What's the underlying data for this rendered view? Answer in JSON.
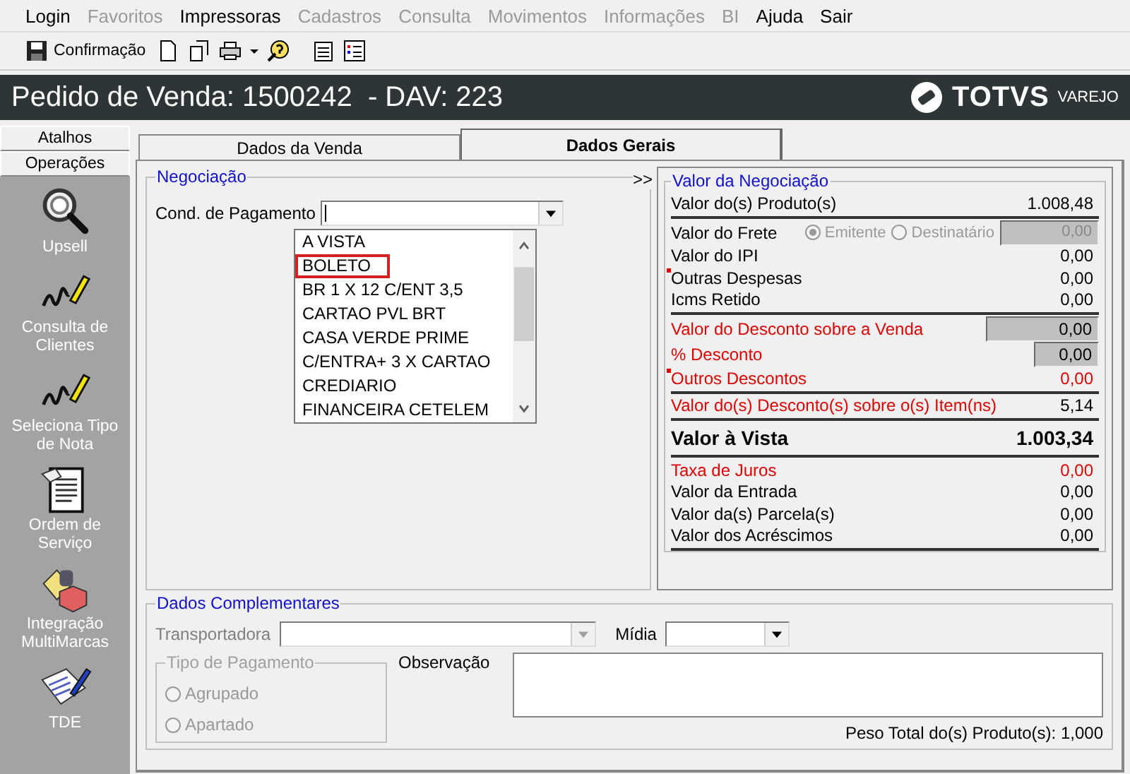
{
  "menu": [
    {
      "label": "Login",
      "disabled": false
    },
    {
      "label": "Favoritos",
      "disabled": true
    },
    {
      "label": "Impressoras",
      "disabled": false
    },
    {
      "label": "Cadastros",
      "disabled": true
    },
    {
      "label": "Consulta",
      "disabled": true
    },
    {
      "label": "Movimentos",
      "disabled": true
    },
    {
      "label": "Informações",
      "disabled": true
    },
    {
      "label": "BI",
      "disabled": true
    },
    {
      "label": "Ajuda",
      "disabled": false
    },
    {
      "label": "Sair",
      "disabled": false
    }
  ],
  "toolbar": {
    "confirm_label": "Confirmação"
  },
  "header": {
    "title": "Pedido de Venda: 1500242  - DAV: 223",
    "logo": "TOTVS",
    "logo_sub": "VAREJO"
  },
  "sidebar": {
    "tabs": [
      {
        "label": "Atalhos"
      },
      {
        "label": "Operações"
      }
    ],
    "items": [
      {
        "label": "Upsell",
        "kind": "magnifier"
      },
      {
        "label": "Consulta de Clientes",
        "kind": "pen"
      },
      {
        "label": "Seleciona Tipo de Nota",
        "kind": "pen"
      },
      {
        "label": "Ordem de Serviço",
        "kind": "document"
      },
      {
        "label": "Integração MultiMarcas",
        "kind": "package"
      },
      {
        "label": "TDE",
        "kind": "papers"
      }
    ]
  },
  "tabs": [
    {
      "label": "Dados da Venda",
      "selected": false
    },
    {
      "label": "Dados Gerais",
      "selected": true
    }
  ],
  "negotiation": {
    "title": "Negociação",
    "expand": ">>",
    "payment_label": "Cond. de Pagamento",
    "options": [
      {
        "label": "A VISTA",
        "highlighted": false
      },
      {
        "label": "BOLETO",
        "highlighted": true
      },
      {
        "label": "BR 1 X 12 C/ENT 3,5",
        "highlighted": false
      },
      {
        "label": "CARTAO PVL BRT",
        "highlighted": false
      },
      {
        "label": "CASA VERDE PRIME",
        "highlighted": false
      },
      {
        "label": "C/ENTRA+ 3 X CARTAO",
        "highlighted": false
      },
      {
        "label": "CREDIARIO",
        "highlighted": false
      },
      {
        "label": "FINANCEIRA CETELEM",
        "highlighted": false
      }
    ]
  },
  "values": {
    "title": "Valor da Negociação",
    "sections": [
      {
        "rows": [
          {
            "kind": "text",
            "label": "Valor do(s) Produto(s)",
            "value": "1.008,48",
            "alert": false,
            "value_alert": false
          }
        ]
      },
      {
        "rows": [
          {
            "kind": "freight",
            "label": "Valor do Frete",
            "value": "0,00",
            "alert": false,
            "disabled": true,
            "options": [
              {
                "label": "Emitente",
                "selected": true
              },
              {
                "label": "Destinatário",
                "selected": false
              }
            ]
          },
          {
            "kind": "text",
            "label": "Valor do IPI",
            "value": "0,00",
            "alert": false,
            "value_alert": false
          },
          {
            "kind": "text",
            "label": "Outras Despesas",
            "value": "0,00",
            "alert": false,
            "value_alert": false,
            "flagged": true
          },
          {
            "kind": "text",
            "label": "Icms Retido",
            "value": "0,00",
            "alert": false,
            "value_alert": false
          }
        ]
      },
      {
        "rows": [
          {
            "kind": "field",
            "label": "Valor do Desconto sobre a Venda",
            "value": "0,00",
            "alert": true
          },
          {
            "kind": "small-field",
            "label": "% Desconto",
            "value": "0,00",
            "alert": true
          },
          {
            "kind": "text",
            "label": "Outros Descontos",
            "value": "0,00",
            "alert": true,
            "value_alert": true,
            "flagged": true
          }
        ]
      },
      {
        "rows": [
          {
            "kind": "text",
            "label": "Valor do(s) Desconto(s) sobre o(s) Item(ns)",
            "value": "5,14",
            "alert": true,
            "value_alert": false
          }
        ]
      },
      {
        "rows": [
          {
            "kind": "total",
            "label": "Valor à Vista",
            "value": "1.003,34",
            "alert": false
          }
        ]
      },
      {
        "rows": [
          {
            "kind": "text",
            "label": "Taxa de Juros",
            "value": "0,00",
            "alert": true,
            "value_alert": true
          },
          {
            "kind": "text",
            "label": "Valor da Entrada",
            "value": "0,00",
            "alert": false,
            "value_alert": false
          },
          {
            "kind": "text",
            "label": "Valor da(s) Parcela(s)",
            "value": "0,00",
            "alert": false,
            "value_alert": false
          },
          {
            "kind": "text",
            "label": "Valor dos Acréscimos",
            "value": "0,00",
            "alert": false,
            "value_alert": false
          }
        ]
      }
    ]
  },
  "complementary": {
    "title": "Dados Complementares",
    "carrier_label": "Transportadora",
    "carrier_disabled": true,
    "media_label": "Mídia",
    "payment_type": {
      "title": "Tipo de Pagamento",
      "disabled": true,
      "options": [
        {
          "label": "Agrupado",
          "selected": false
        },
        {
          "label": "Apartado",
          "selected": false
        }
      ]
    },
    "notes_label": "Observação",
    "weight": "Peso Total do(s) Produto(s): 1,000"
  }
}
